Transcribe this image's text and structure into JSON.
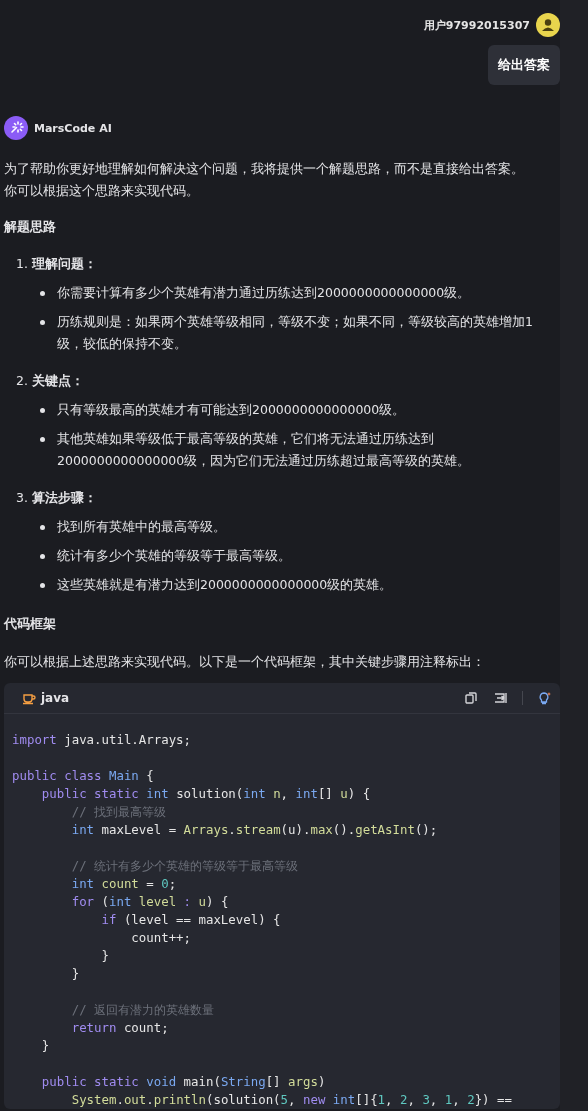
{
  "user_message": {
    "username": "用户97992015307",
    "text": "给出答案"
  },
  "assistant": {
    "name": "MarsCode AI",
    "intro": [
      "为了帮助你更好地理解如何解决这个问题，我将提供一个解题思路，而不是直接给出答案。",
      "你可以根据这个思路来实现代码。"
    ],
    "heading_1": "解题思路",
    "steps": [
      {
        "number": "1.",
        "title": "理解问题：",
        "bullets": [
          "你需要计算有多少个英雄有潜力通过历练达到2000000000000000级。",
          "历练规则是：如果两个英雄等级相同，等级不变；如果不同，等级较高的英雄增加1级，较低的保持不变。"
        ]
      },
      {
        "number": "2.",
        "title": "关键点：",
        "bullets": [
          "只有等级最高的英雄才有可能达到2000000000000000级。",
          "其他英雄如果等级低于最高等级的英雄，它们将无法通过历练达到2000000000000000级，因为它们无法通过历练超过最高等级的英雄。"
        ]
      },
      {
        "number": "3.",
        "title": "算法步骤：",
        "bullets": [
          "找到所有英雄中的最高等级。",
          "统计有多少个英雄的等级等于最高等级。",
          "这些英雄就是有潜力达到2000000000000000级的英雄。"
        ]
      }
    ],
    "heading_2": "代码框架",
    "code_intro": "你可以根据上述思路来实现代码。以下是一个代码框架，其中关键步骤用注释标出：",
    "code_block": {
      "language": "java",
      "lines": [
        {
          "kind": "code",
          "tokens": [
            {
              "text": "import",
              "kind": "keyword"
            },
            {
              "text": " java.util.Arrays;",
              "kind": "plain"
            }
          ]
        },
        {
          "kind": "blank"
        },
        {
          "kind": "code",
          "tokens": [
            {
              "text": "public class ",
              "kind": "keyword"
            },
            {
              "text": "Main",
              "kind": "type"
            },
            {
              "text": " {",
              "kind": "plain"
            }
          ]
        },
        {
          "kind": "code",
          "tokens": [
            {
              "text": "    public static ",
              "kind": "keyword"
            },
            {
              "text": "int",
              "kind": "type"
            },
            {
              "text": " solution(",
              "kind": "plain"
            },
            {
              "text": "int",
              "kind": "type"
            },
            {
              "text": " n",
              "kind": "variable"
            },
            {
              "text": ", ",
              "kind": "plain"
            },
            {
              "text": "int",
              "kind": "type"
            },
            {
              "text": "[] ",
              "kind": "plain"
            },
            {
              "text": "u",
              "kind": "variable"
            },
            {
              "text": ") {",
              "kind": "plain"
            }
          ]
        },
        {
          "kind": "code",
          "tokens": [
            {
              "text": "        // 找到最高等级",
              "kind": "comment"
            }
          ]
        },
        {
          "kind": "code",
          "tokens": [
            {
              "text": "        int",
              "kind": "type"
            },
            {
              "text": " maxLevel = ",
              "kind": "plain"
            },
            {
              "text": "Arrays",
              "kind": "variable"
            },
            {
              "text": ".",
              "kind": "plain"
            },
            {
              "text": "stream",
              "kind": "function"
            },
            {
              "text": "(u).",
              "kind": "plain"
            },
            {
              "text": "max",
              "kind": "function"
            },
            {
              "text": "().",
              "kind": "plain"
            },
            {
              "text": "getAsInt",
              "kind": "function"
            },
            {
              "text": "();",
              "kind": "plain"
            }
          ]
        },
        {
          "kind": "blank"
        },
        {
          "kind": "code",
          "tokens": [
            {
              "text": "        // 统计有多少个英雄的等级等于最高等级",
              "kind": "comment"
            }
          ]
        },
        {
          "kind": "code",
          "tokens": [
            {
              "text": "        int",
              "kind": "type"
            },
            {
              "text": " count",
              "kind": "variable"
            },
            {
              "text": " = ",
              "kind": "plain"
            },
            {
              "text": "0",
              "kind": "number"
            },
            {
              "text": ";",
              "kind": "plain"
            }
          ]
        },
        {
          "kind": "code",
          "tokens": [
            {
              "text": "        for",
              "kind": "keyword"
            },
            {
              "text": " (",
              "kind": "plain"
            },
            {
              "text": "int",
              "kind": "type"
            },
            {
              "text": " level",
              "kind": "variable"
            },
            {
              "text": " : ",
              "kind": "keyword"
            },
            {
              "text": "u",
              "kind": "variable"
            },
            {
              "text": ") {",
              "kind": "plain"
            }
          ]
        },
        {
          "kind": "code",
          "tokens": [
            {
              "text": "            if",
              "kind": "keyword"
            },
            {
              "text": " (level == maxLevel) {",
              "kind": "plain"
            }
          ]
        },
        {
          "kind": "code",
          "tokens": [
            {
              "text": "                count++;",
              "kind": "plain"
            }
          ]
        },
        {
          "kind": "code",
          "tokens": [
            {
              "text": "            }",
              "kind": "plain"
            }
          ]
        },
        {
          "kind": "code",
          "tokens": [
            {
              "text": "        }",
              "kind": "plain"
            }
          ]
        },
        {
          "kind": "blank"
        },
        {
          "kind": "code",
          "tokens": [
            {
              "text": "        // 返回有潜力的英雄数量",
              "kind": "comment"
            }
          ]
        },
        {
          "kind": "code",
          "tokens": [
            {
              "text": "        return",
              "kind": "keyword"
            },
            {
              "text": " count;",
              "kind": "plain"
            }
          ]
        },
        {
          "kind": "code",
          "tokens": [
            {
              "text": "    }",
              "kind": "plain"
            }
          ]
        },
        {
          "kind": "blank"
        },
        {
          "kind": "code",
          "tokens": [
            {
              "text": "    public static ",
              "kind": "keyword"
            },
            {
              "text": "void",
              "kind": "type"
            },
            {
              "text": " main(",
              "kind": "plain"
            },
            {
              "text": "String",
              "kind": "type"
            },
            {
              "text": "[] ",
              "kind": "plain"
            },
            {
              "text": "args",
              "kind": "variable"
            },
            {
              "text": ")",
              "kind": "plain"
            }
          ]
        },
        {
          "kind": "code",
          "tokens": [
            {
              "text": "        System",
              "kind": "variable"
            },
            {
              "text": ".",
              "kind": "plain"
            },
            {
              "text": "out",
              "kind": "variable"
            },
            {
              "text": ".",
              "kind": "plain"
            },
            {
              "text": "println",
              "kind": "function"
            },
            {
              "text": "(solution(",
              "kind": "plain"
            },
            {
              "text": "5",
              "kind": "number"
            },
            {
              "text": ", ",
              "kind": "plain"
            },
            {
              "text": "new ",
              "kind": "keyword"
            },
            {
              "text": "int",
              "kind": "type"
            },
            {
              "text": "[]{",
              "kind": "plain"
            },
            {
              "text": "1",
              "kind": "number"
            },
            {
              "text": ", ",
              "kind": "plain"
            },
            {
              "text": "2",
              "kind": "number"
            },
            {
              "text": ", ",
              "kind": "plain"
            },
            {
              "text": "3",
              "kind": "number"
            },
            {
              "text": ", ",
              "kind": "plain"
            },
            {
              "text": "1",
              "kind": "number"
            },
            {
              "text": ", ",
              "kind": "plain"
            },
            {
              "text": "2",
              "kind": "number"
            },
            {
              "text": "}) ==",
              "kind": "plain"
            }
          ]
        }
      ]
    }
  }
}
